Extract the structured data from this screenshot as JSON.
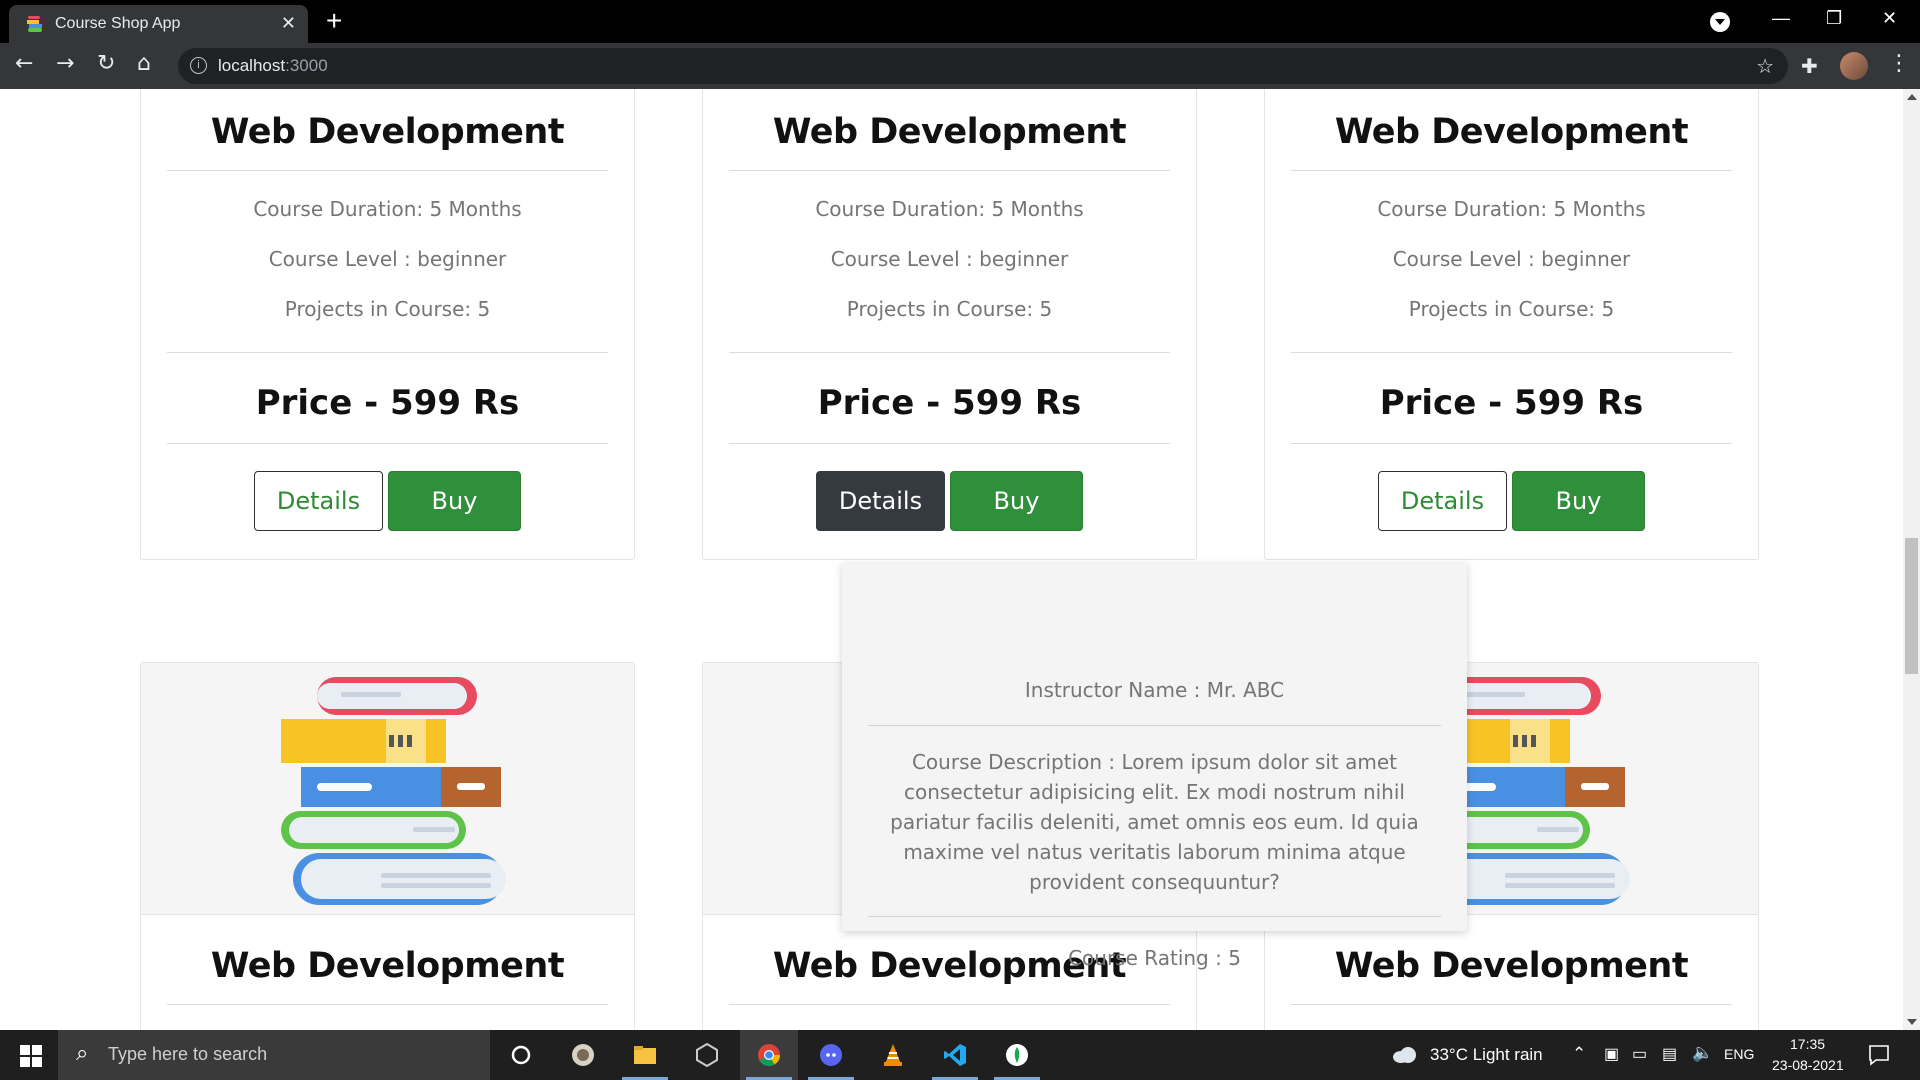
{
  "browser": {
    "tab_title": "Course Shop App",
    "url_host": "localhost",
    "url_port": ":3000"
  },
  "cards_top": [
    {
      "title": "Web Development",
      "duration": "Course Duration: 5 Months",
      "level": "Course Level : beginner",
      "projects": "Projects in Course: 5",
      "price": "Price - 599 Rs",
      "details_label": "Details",
      "buy_label": "Buy"
    },
    {
      "title": "Web Development",
      "duration": "Course Duration: 5 Months",
      "level": "Course Level : beginner",
      "projects": "Projects in Course: 5",
      "price": "Price - 599 Rs",
      "details_label": "Details",
      "buy_label": "Buy"
    },
    {
      "title": "Web Development",
      "duration": "Course Duration: 5 Months",
      "level": "Course Level : beginner",
      "projects": "Projects in Course: 5",
      "price": "Price - 599 Rs",
      "details_label": "Details",
      "buy_label": "Buy"
    }
  ],
  "cards_bottom": [
    {
      "title": "Web Development"
    },
    {
      "title": "Web Development"
    },
    {
      "title": "Web Development"
    }
  ],
  "popover": {
    "instructor": "Instructor Name : Mr. ABC",
    "description_lines": [
      "Course Description : Lorem ipsum dolor sit amet",
      "consectetur adipisicing elit. Ex modi nostrum nihil",
      "pariatur facilis deleniti, amet omnis eos eum. Id quia",
      "maxime vel natus veritatis laborum minima atque",
      "provident consequuntur?"
    ],
    "rating": "Course Rating : 5"
  },
  "taskbar": {
    "search_placeholder": "Type here to search",
    "weather": "33°C  Light rain",
    "language": "ENG",
    "time": "17:35",
    "date": "23-08-2021"
  },
  "colors": {
    "buy_green": "#2f8f3a",
    "details_active": "#343a40",
    "details_text_green": "#2e8b32"
  }
}
